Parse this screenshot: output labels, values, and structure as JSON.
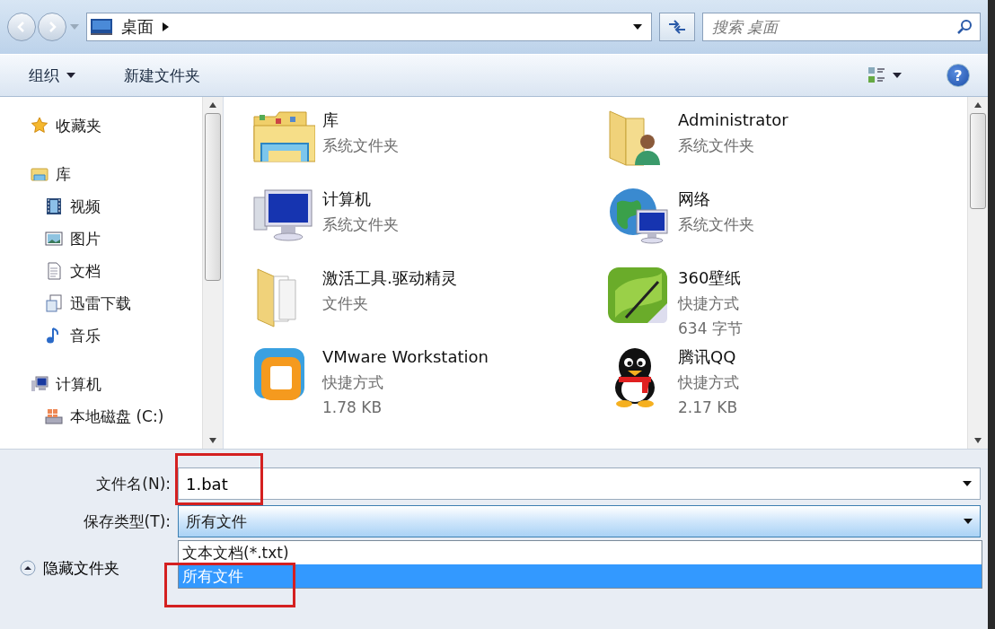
{
  "navigation": {
    "address": "桌面",
    "search_placeholder": "搜索 桌面"
  },
  "toolbar": {
    "organize": "组织",
    "new_folder": "新建文件夹",
    "help": "?"
  },
  "sidebar": {
    "items": [
      {
        "label": "收藏夹",
        "kind": "favorites"
      },
      {
        "label": "库",
        "kind": "library",
        "children": [
          {
            "label": "视频",
            "kind": "video"
          },
          {
            "label": "图片",
            "kind": "pictures"
          },
          {
            "label": "文档",
            "kind": "documents"
          },
          {
            "label": "迅雷下载",
            "kind": "download"
          },
          {
            "label": "音乐",
            "kind": "music"
          }
        ]
      },
      {
        "label": "计算机",
        "kind": "computer",
        "children": [
          {
            "label": "本地磁盘 (C:)",
            "kind": "drive"
          }
        ]
      }
    ]
  },
  "files": [
    {
      "name": "库",
      "details": [
        "系统文件夹"
      ],
      "kind": "library"
    },
    {
      "name": "Administrator",
      "details": [
        "系统文件夹"
      ],
      "kind": "user"
    },
    {
      "name": "计算机",
      "details": [
        "系统文件夹"
      ],
      "kind": "computer"
    },
    {
      "name": "网络",
      "details": [
        "系统文件夹"
      ],
      "kind": "network"
    },
    {
      "name": "激活工具.驱动精灵",
      "details": [
        "文件夹"
      ],
      "kind": "folder"
    },
    {
      "name": "360壁纸",
      "details": [
        "快捷方式",
        "634 字节"
      ],
      "kind": "wallpaper"
    },
    {
      "name": "VMware Workstation",
      "details": [
        "快捷方式",
        "1.78 KB"
      ],
      "kind": "vmware"
    },
    {
      "name": "腾讯QQ",
      "details": [
        "快捷方式",
        "2.17 KB"
      ],
      "kind": "penguin"
    }
  ],
  "form": {
    "file_name": {
      "label": "文件名(N):",
      "value": "1.bat",
      "highlighted": true
    },
    "save_type": {
      "label": "保存类型(T):",
      "value": "所有文件",
      "expanded": true,
      "options": [
        {
          "label": "文本文档(*.txt)",
          "selected": false,
          "highlighted": false
        },
        {
          "label": "所有文件",
          "selected": true,
          "highlighted": true
        }
      ]
    },
    "hide_folders": "隐藏文件夹"
  }
}
